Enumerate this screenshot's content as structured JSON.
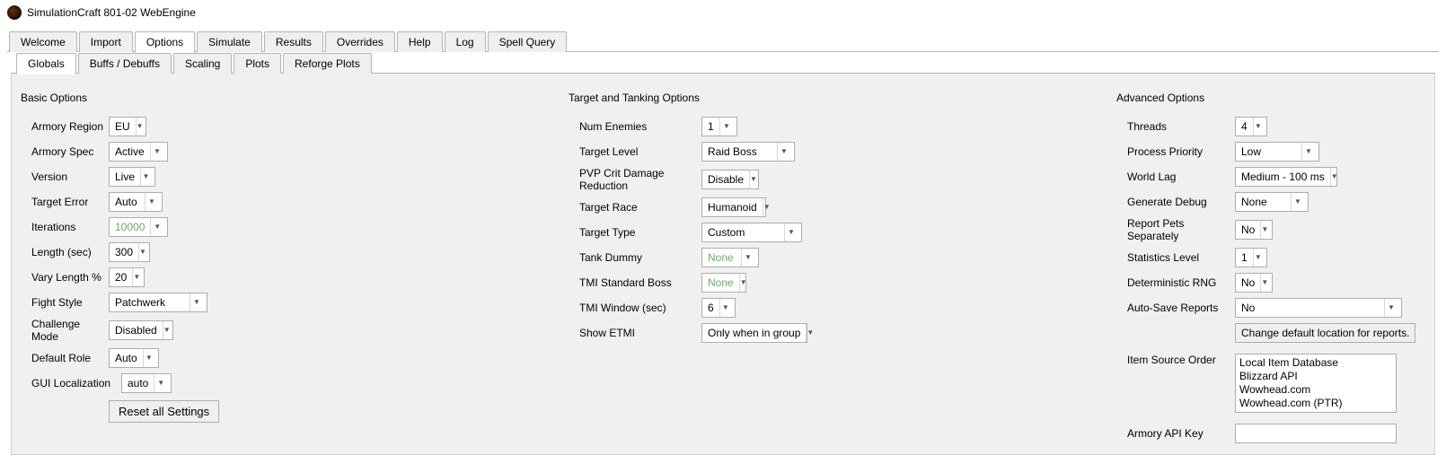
{
  "window": {
    "title": "SimulationCraft 801-02 WebEngine"
  },
  "main_tabs": [
    "Welcome",
    "Import",
    "Options",
    "Simulate",
    "Results",
    "Overrides",
    "Help",
    "Log",
    "Spell Query"
  ],
  "main_tab_active": "Options",
  "sub_tabs": [
    "Globals",
    "Buffs / Debuffs",
    "Scaling",
    "Plots",
    "Reforge Plots"
  ],
  "sub_tab_active": "Globals",
  "sections": {
    "basic": {
      "title": "Basic Options",
      "armory_region": {
        "label": "Armory Region",
        "value": "EU"
      },
      "armory_spec": {
        "label": "Armory Spec",
        "value": "Active"
      },
      "version": {
        "label": "Version",
        "value": "Live"
      },
      "target_error": {
        "label": "Target Error",
        "value": "Auto"
      },
      "iterations": {
        "label": "Iterations",
        "value": "10000",
        "disabled": true
      },
      "length": {
        "label": "Length (sec)",
        "value": "300"
      },
      "vary_length": {
        "label": "Vary Length %",
        "value": "20"
      },
      "fight_style": {
        "label": "Fight Style",
        "value": "Patchwerk"
      },
      "challenge_mode": {
        "label": "Challenge Mode",
        "value": "Disabled"
      },
      "default_role": {
        "label": "Default Role",
        "value": "Auto"
      },
      "gui_localization": {
        "label": "GUI Localization",
        "value": "auto"
      },
      "reset_button": "Reset all Settings"
    },
    "target": {
      "title": "Target and Tanking Options",
      "num_enemies": {
        "label": "Num Enemies",
        "value": "1"
      },
      "target_level": {
        "label": "Target Level",
        "value": "Raid Boss"
      },
      "pvp_crit": {
        "label": "PVP Crit Damage Reduction",
        "value": "Disable"
      },
      "target_race": {
        "label": "Target Race",
        "value": "Humanoid"
      },
      "target_type": {
        "label": "Target Type",
        "value": "Custom"
      },
      "tank_dummy": {
        "label": "Tank Dummy",
        "value": "None",
        "disabled": true
      },
      "tmi_boss": {
        "label": "TMI Standard Boss",
        "value": "None",
        "disabled": true
      },
      "tmi_window": {
        "label": "TMI Window (sec)",
        "value": "6"
      },
      "show_etmi": {
        "label": "Show ETMI",
        "value": "Only when in group"
      }
    },
    "advanced": {
      "title": "Advanced Options",
      "threads": {
        "label": "Threads",
        "value": "4"
      },
      "process_priority": {
        "label": "Process Priority",
        "value": "Low"
      },
      "world_lag": {
        "label": "World Lag",
        "value": "Medium - 100 ms"
      },
      "generate_debug": {
        "label": "Generate Debug",
        "value": "None"
      },
      "report_pets": {
        "label": "Report Pets Separately",
        "value": "No"
      },
      "statistics_level": {
        "label": "Statistics Level",
        "value": "1"
      },
      "deterministic_rng": {
        "label": "Deterministic RNG",
        "value": "No"
      },
      "auto_save": {
        "label": "Auto-Save Reports",
        "value": "No"
      },
      "change_location_button": "Change default location for reports.",
      "item_source": {
        "label": "Item Source Order",
        "items": [
          "Local Item Database",
          "Blizzard API",
          "Wowhead.com",
          "Wowhead.com (PTR)"
        ]
      },
      "armory_api_key": {
        "label": "Armory API Key",
        "value": ""
      }
    }
  }
}
